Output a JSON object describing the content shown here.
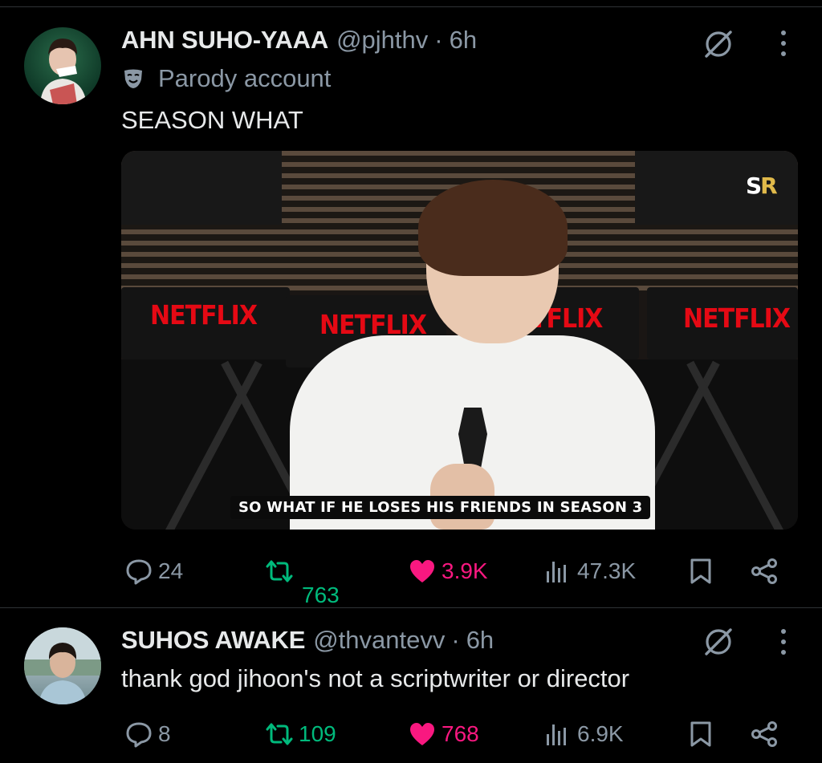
{
  "tweets": [
    {
      "author_name": "AHN SUHO-YAAA",
      "handle": "@pjhthv",
      "time": "6h",
      "label": "Parody account",
      "text": "SEASON WHAT",
      "media": {
        "watermark": "SR",
        "chair_labels": [
          "NETFLIX",
          "NETFLIX",
          "TFLIX",
          "NETFLIX"
        ],
        "caption": "SO WHAT IF HE LOSES HIS FRIENDS IN SEASON 3"
      },
      "actions": {
        "replies": "24",
        "retweets": "763",
        "likes": "3.9K",
        "views": "47.3K"
      }
    },
    {
      "author_name": "SUHOS AWAKE",
      "handle": "@thvantevv",
      "time": "6h",
      "text": "thank god jihoon's not a scriptwriter or director",
      "actions": {
        "replies": "8",
        "retweets": "109",
        "likes": "768",
        "views": "6.9K"
      }
    }
  ],
  "separator": "·",
  "icons": [
    "reply-icon",
    "retweet-icon",
    "like-icon",
    "views-icon",
    "bookmark-icon",
    "share-icon",
    "grok-icon",
    "more-icon",
    "parody-mask-icon"
  ],
  "colors": {
    "background": "#000000",
    "text": "#e7e9ea",
    "muted": "#8b98a5",
    "retweet": "#00ba7c",
    "like": "#f91880",
    "divider": "#2f3336"
  }
}
